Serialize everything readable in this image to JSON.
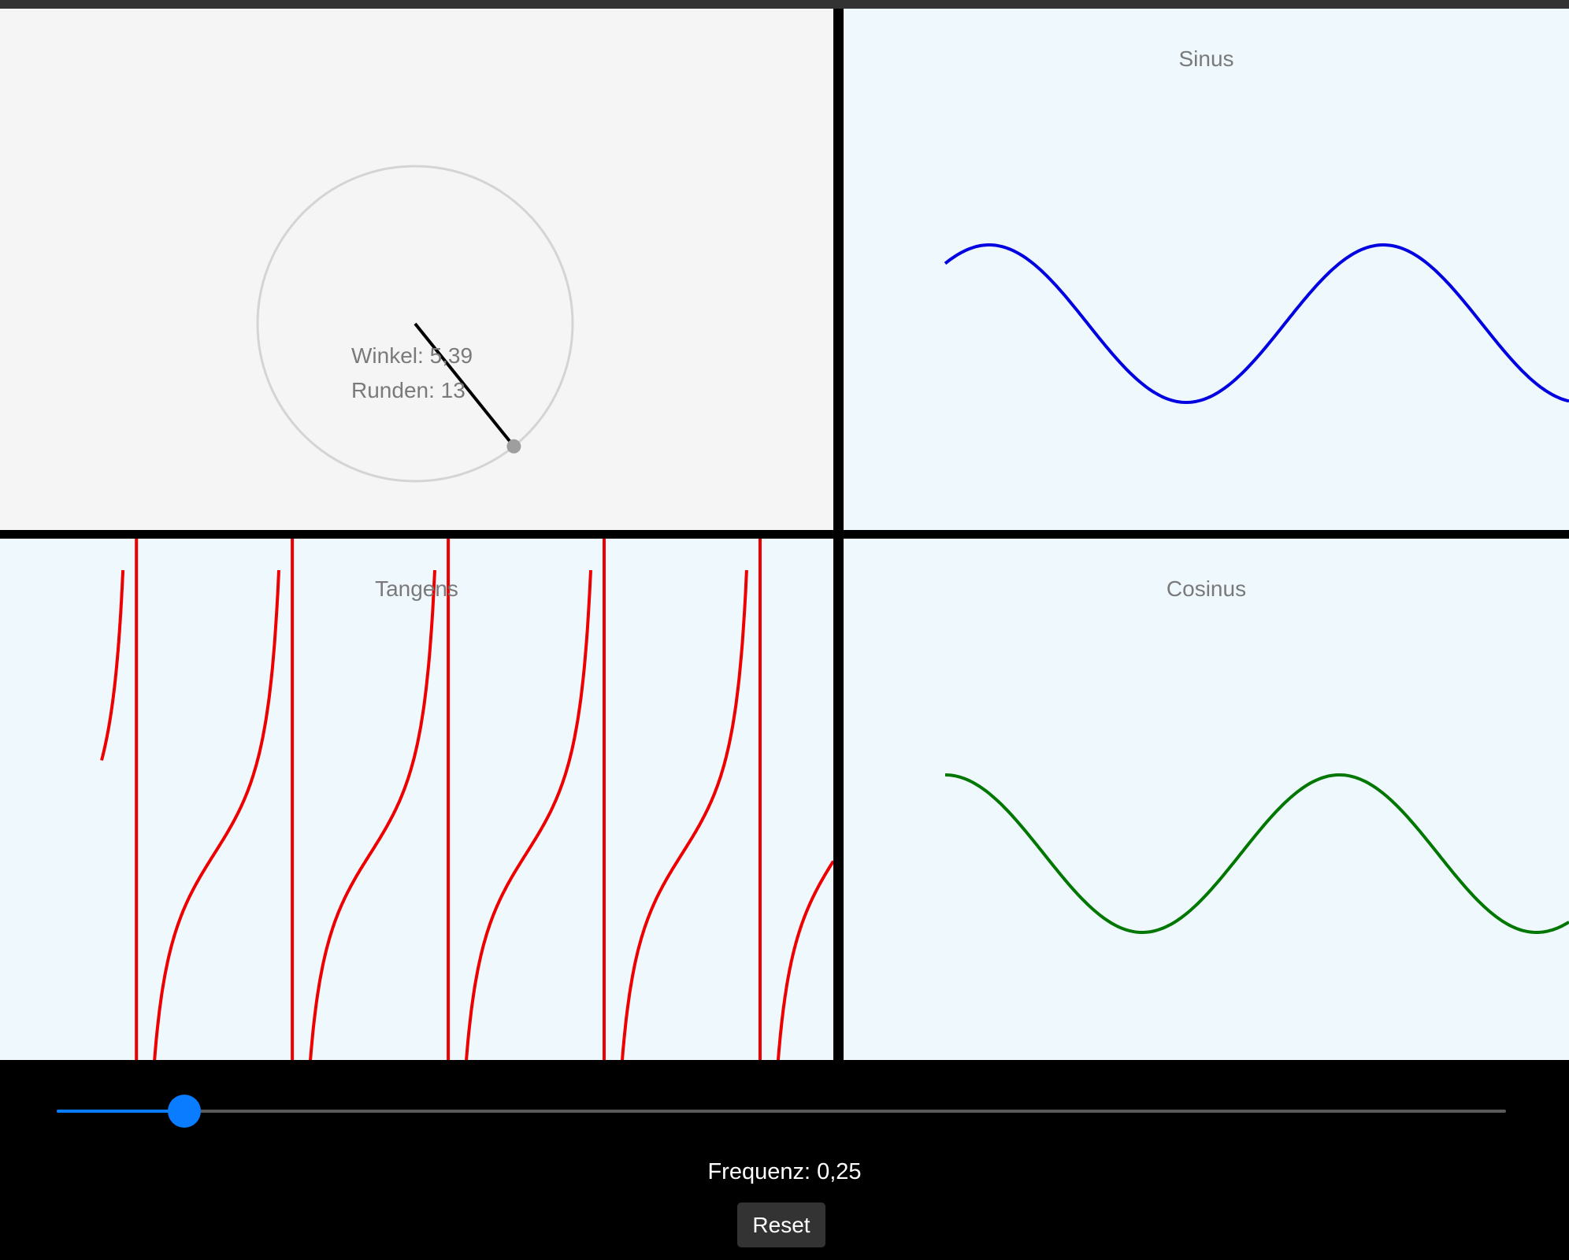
{
  "colors": {
    "circle_panel_bg": "#f5f5f5",
    "graph_panel_bg": "#eff8fd",
    "label_text": "#7a7a7a",
    "unit_circle": "#d4d4d4",
    "radius_line": "#000000",
    "point": "#9e9e9e",
    "sine": "#0000e0",
    "cosine": "#007700",
    "tangent": "#ee0000",
    "slider_accent": "#0a7cff",
    "button_bg": "#333333"
  },
  "circle_panel": {
    "angle_text": "Winkel: 5,39",
    "rounds_text": "Runden: 13",
    "angle": 5.39
  },
  "sine_panel": {
    "title": "Sinus"
  },
  "cosine_panel": {
    "title": "Cosinus"
  },
  "tangent_panel": {
    "title": "Tangens"
  },
  "controls": {
    "frequency_label": "Frequenz: 0,25",
    "slider_value_fraction": 0.088,
    "reset_label": "Reset"
  }
}
